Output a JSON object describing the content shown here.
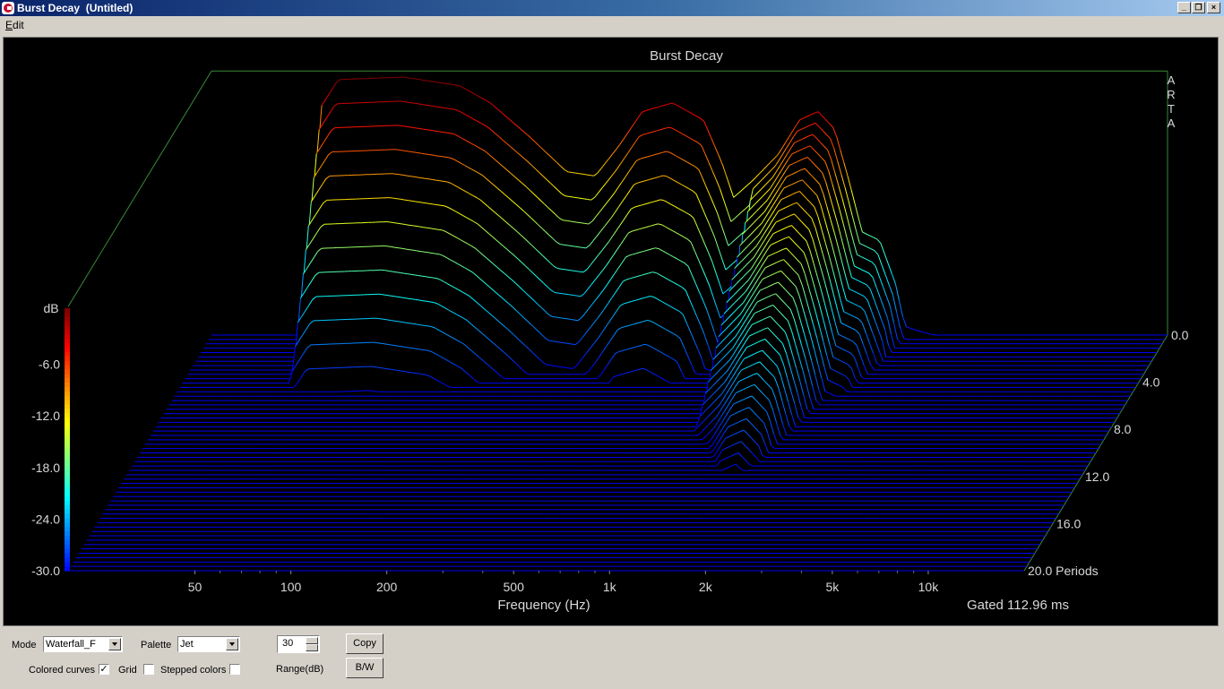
{
  "window": {
    "title": "Burst Decay  (Untitled)"
  },
  "menu": {
    "items": [
      "Edit"
    ]
  },
  "chart_data": {
    "type": "waterfall",
    "title": "Burst Decay",
    "watermark": "ARTA",
    "xlabel": "Frequency (Hz)",
    "x_scale": "log",
    "xlim": [
      20,
      20000
    ],
    "x_tick_labels": [
      "50",
      "100",
      "200",
      "500",
      "1k",
      "2k",
      "5k",
      "10k"
    ],
    "x_tick_values": [
      50,
      100,
      200,
      500,
      1000,
      2000,
      5000,
      10000
    ],
    "zlabel": "dB",
    "zlim": [
      -30,
      0
    ],
    "z_tick_labels": [
      "-6.0",
      "-12.0",
      "-18.0",
      "-24.0",
      "-30.0"
    ],
    "z_tick_values": [
      -6,
      -12,
      -18,
      -24,
      -30
    ],
    "depth_tick_labels": [
      "0.0",
      "4.0",
      "8.0",
      "12.0",
      "16.0",
      "20.0 Periods"
    ],
    "depth_tick_values": [
      0,
      4,
      8,
      12,
      16,
      20
    ],
    "depth_unit": "Periods",
    "depth_lim": [
      0,
      20
    ],
    "slice_count": 55,
    "gated_label": "Gated 112.96 ms",
    "palette": "Jet",
    "background": "#000000",
    "grid": false,
    "front_slice": {
      "freq": [
        20,
        40,
        44,
        50,
        80,
        120,
        150,
        200,
        260,
        320,
        380,
        450,
        560,
        700,
        800,
        870,
        1000,
        1200,
        1400,
        1600,
        1800,
        2000,
        2200,
        2500,
        2800,
        3000,
        3300,
        3700,
        4200,
        5000,
        6000,
        7000,
        8000,
        10000,
        15000,
        20000
      ],
      "db": [
        -30,
        -30,
        -3.5,
        -0.3,
        0,
        -1,
        -3,
        -7,
        -11,
        -11.5,
        -8,
        -4,
        -3,
        -5,
        -10,
        -14,
        -12,
        -9,
        -5,
        -4,
        -6,
        -12,
        -18,
        -19,
        -24,
        -29,
        -29.5,
        -30,
        -30,
        -30,
        -30,
        -30,
        -30,
        -30,
        -30,
        -30
      ]
    },
    "mode": "Waterfall_F"
  },
  "controls": {
    "mode_label": "Mode",
    "mode_value": "Waterfall_F",
    "palette_label": "Palette",
    "palette_value": "Jet",
    "range_value": "30",
    "range_label": "Range(dB)",
    "copy_label": "Copy",
    "bw_label": "B/W",
    "colored_curves_label": "Colored curves",
    "colored_curves_checked": true,
    "grid_label": "Grid",
    "grid_checked": false,
    "stepped_colors_label": "Stepped colors",
    "stepped_colors_checked": false
  }
}
